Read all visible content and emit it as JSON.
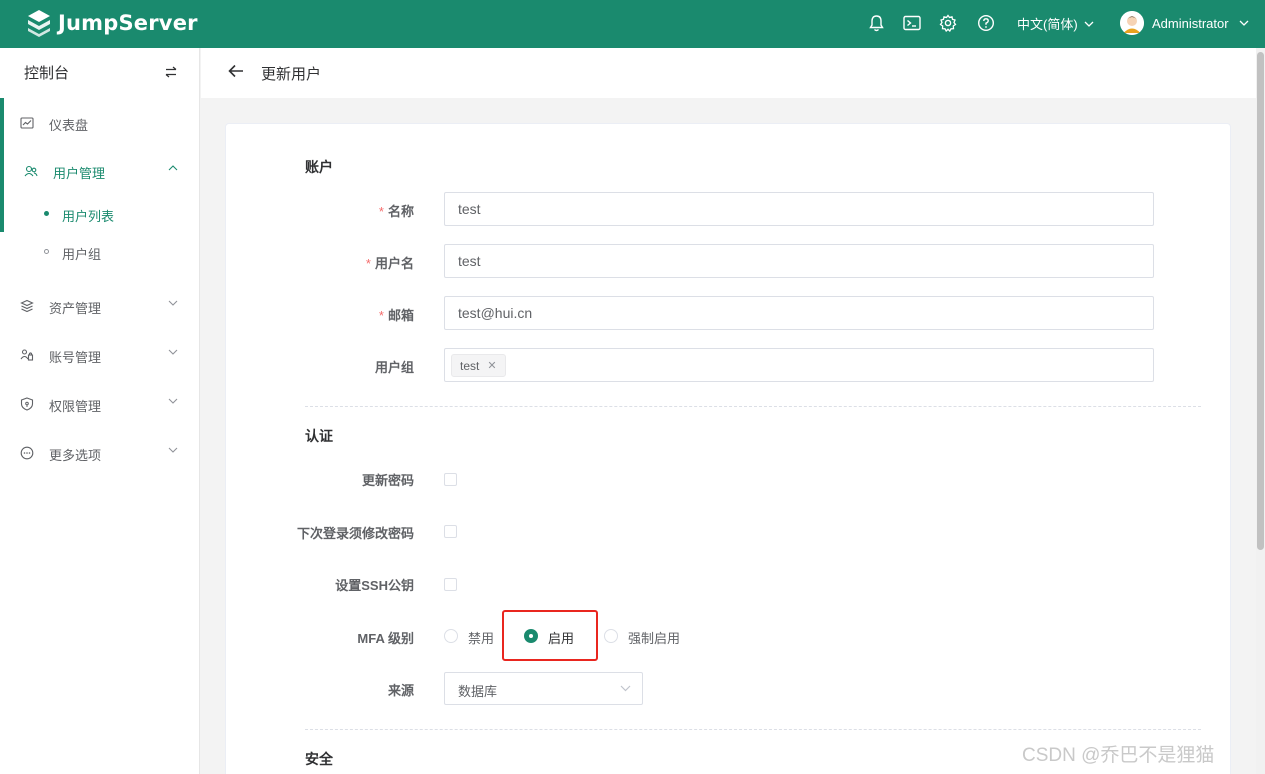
{
  "app": {
    "brand": "JumpServer",
    "language": "中文(简体)",
    "username": "Administrator"
  },
  "sidebar": {
    "header": "控制台",
    "items": [
      {
        "label": "仪表盘",
        "icon": "dashboard-icon"
      },
      {
        "label": "用户管理",
        "icon": "users-icon",
        "expanded": true
      },
      {
        "label": "资产管理",
        "icon": "assets-icon"
      },
      {
        "label": "账号管理",
        "icon": "accounts-icon"
      },
      {
        "label": "权限管理",
        "icon": "permissions-icon"
      },
      {
        "label": "更多选项",
        "icon": "more-icon"
      }
    ],
    "subitems": [
      {
        "label": "用户列表",
        "active": true
      },
      {
        "label": "用户组",
        "active": false
      }
    ]
  },
  "page": {
    "title": "更新用户"
  },
  "form": {
    "sections": {
      "account": "账户",
      "auth": "认证",
      "security": "安全"
    },
    "name": {
      "label": "名称",
      "value": "test"
    },
    "username": {
      "label": "用户名",
      "value": "test"
    },
    "email": {
      "label": "邮箱",
      "value": "test@hui.cn"
    },
    "groups": {
      "label": "用户组",
      "tags": [
        "test"
      ]
    },
    "update_password": {
      "label": "更新密码",
      "checked": false
    },
    "must_change_password": {
      "label": "下次登录须修改密码",
      "checked": false
    },
    "set_ssh_key": {
      "label": "设置SSH公钥",
      "checked": false
    },
    "mfa": {
      "label": "MFA 级别",
      "options": [
        "禁用",
        "启用",
        "强制启用"
      ],
      "selected": "启用"
    },
    "source": {
      "label": "来源",
      "value": "数据库"
    }
  },
  "watermark": "CSDN @乔巴不是狸猫",
  "colors": {
    "brand": "#1a8a6e",
    "required": "#f56c6c",
    "highlight": "#e9261f"
  }
}
